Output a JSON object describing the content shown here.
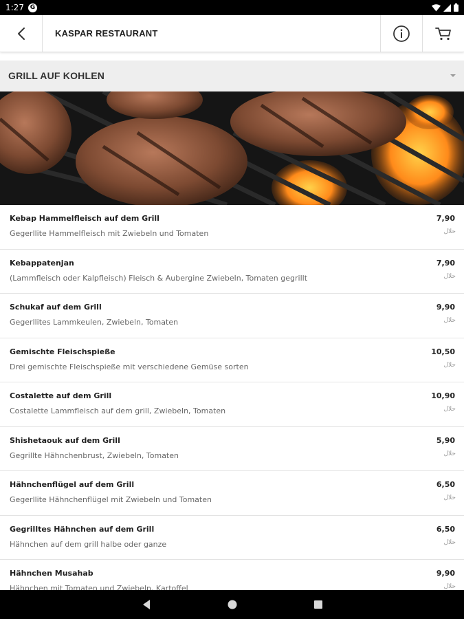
{
  "status_bar": {
    "time": "1:27",
    "app_icon_letter": "G"
  },
  "toolbar": {
    "title": "KASPAR RESTAURANT",
    "back_icon": "back-arrow-icon",
    "info_icon": "info-icon",
    "cart_icon": "cart-icon"
  },
  "category": {
    "label": "GRILL AUF KOHLEN"
  },
  "menu_items": [
    {
      "name": "Kebap Hammelfleisch auf dem Grill",
      "description": "Gegerllite Hammelfleisch mit Zwiebeln und Tomaten",
      "price": "7,90",
      "tag": "حلال"
    },
    {
      "name": "Kebappatenjan",
      "description": "(Lammfleisch oder Kalpfleisch) Fleisch & Aubergine Zwiebeln, Tomaten gegrillt",
      "price": "7,90",
      "tag": "حلال"
    },
    {
      "name": "Schukaf auf dem Grill",
      "description": "Gegerllites Lammkeulen, Zwiebeln, Tomaten",
      "price": "9,90",
      "tag": "حلال"
    },
    {
      "name": "Gemischte Fleischspieße",
      "description": "Drei gemischte Fleischspieße mit verschiedene Gemüse sorten",
      "price": "10,50",
      "tag": "حلال"
    },
    {
      "name": "Costalette auf dem Grill",
      "description": "Costalette Lammfleisch auf dem grill, Zwiebeln, Tomaten",
      "price": "10,90",
      "tag": "حلال"
    },
    {
      "name": "Shishetaouk auf dem Grill",
      "description": "Gegrillte Hähnchenbrust, Zwiebeln, Tomaten",
      "price": "5,90",
      "tag": "حلال"
    },
    {
      "name": "Hähnchenflügel auf dem Grill",
      "description": "Gegerllite Hähnchenflügel mit Zwiebeln und Tomaten",
      "price": "6,50",
      "tag": "حلال"
    },
    {
      "name": "Gegrilltes Hähnchen auf dem Grill",
      "description": "Hähnchen auf dem grill halbe oder ganze",
      "price": "6,50",
      "tag": "حلال"
    },
    {
      "name": "Hähnchen Musahab",
      "description": "Hähnchen mit Tomaten und Zwiebeln, Kartoffel",
      "price": "9,90",
      "tag": "حلال"
    }
  ],
  "colors": {
    "accent_text": "#222222",
    "category_bg": "#eeeeee",
    "divider": "#e3e3e3"
  }
}
